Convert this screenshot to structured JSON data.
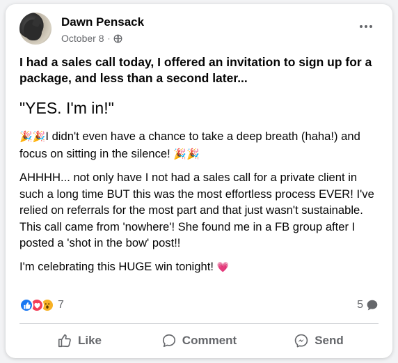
{
  "post": {
    "author": "Dawn Pensack",
    "date": "October 8",
    "separator": "·",
    "privacy_icon": "globe-icon",
    "menu_icon": "more-options-icon",
    "paragraphs": {
      "p1": "I had a sales call today, I offered an invitation to sign up for a package, and less than a second later...",
      "p2": "\"YES. I'm in!\"",
      "p3_emoji_start": "🎉🎉",
      "p3_text": "I didn't even have a chance to take a deep breath (haha!) and focus on sitting in the silence! ",
      "p3_emoji_end": "🎉🎉",
      "p4": "AHHHH... not only have I not had a sales call for a private client in such a long time BUT this was the most effortless process EVER! I've relied on referrals for the most part and that just wasn't sustainable. This call came from 'nowhere'! She found me in a FB group after I posted a 'shot in the bow' post!!",
      "p5_text": "I'm celebrating this HUGE win tonight! ",
      "p5_emoji": "💗"
    }
  },
  "stats": {
    "reaction_icons": [
      "like-reaction-icon",
      "love-reaction-icon",
      "wow-reaction-icon"
    ],
    "reaction_count": "7",
    "comment_count": "5"
  },
  "actions": {
    "like": "Like",
    "comment": "Comment",
    "send": "Send"
  },
  "colors": {
    "like_blue": "#1877f2",
    "love_red": "#f33e58",
    "wow_yellow": "#f7b125",
    "secondary_text": "#65676b"
  }
}
